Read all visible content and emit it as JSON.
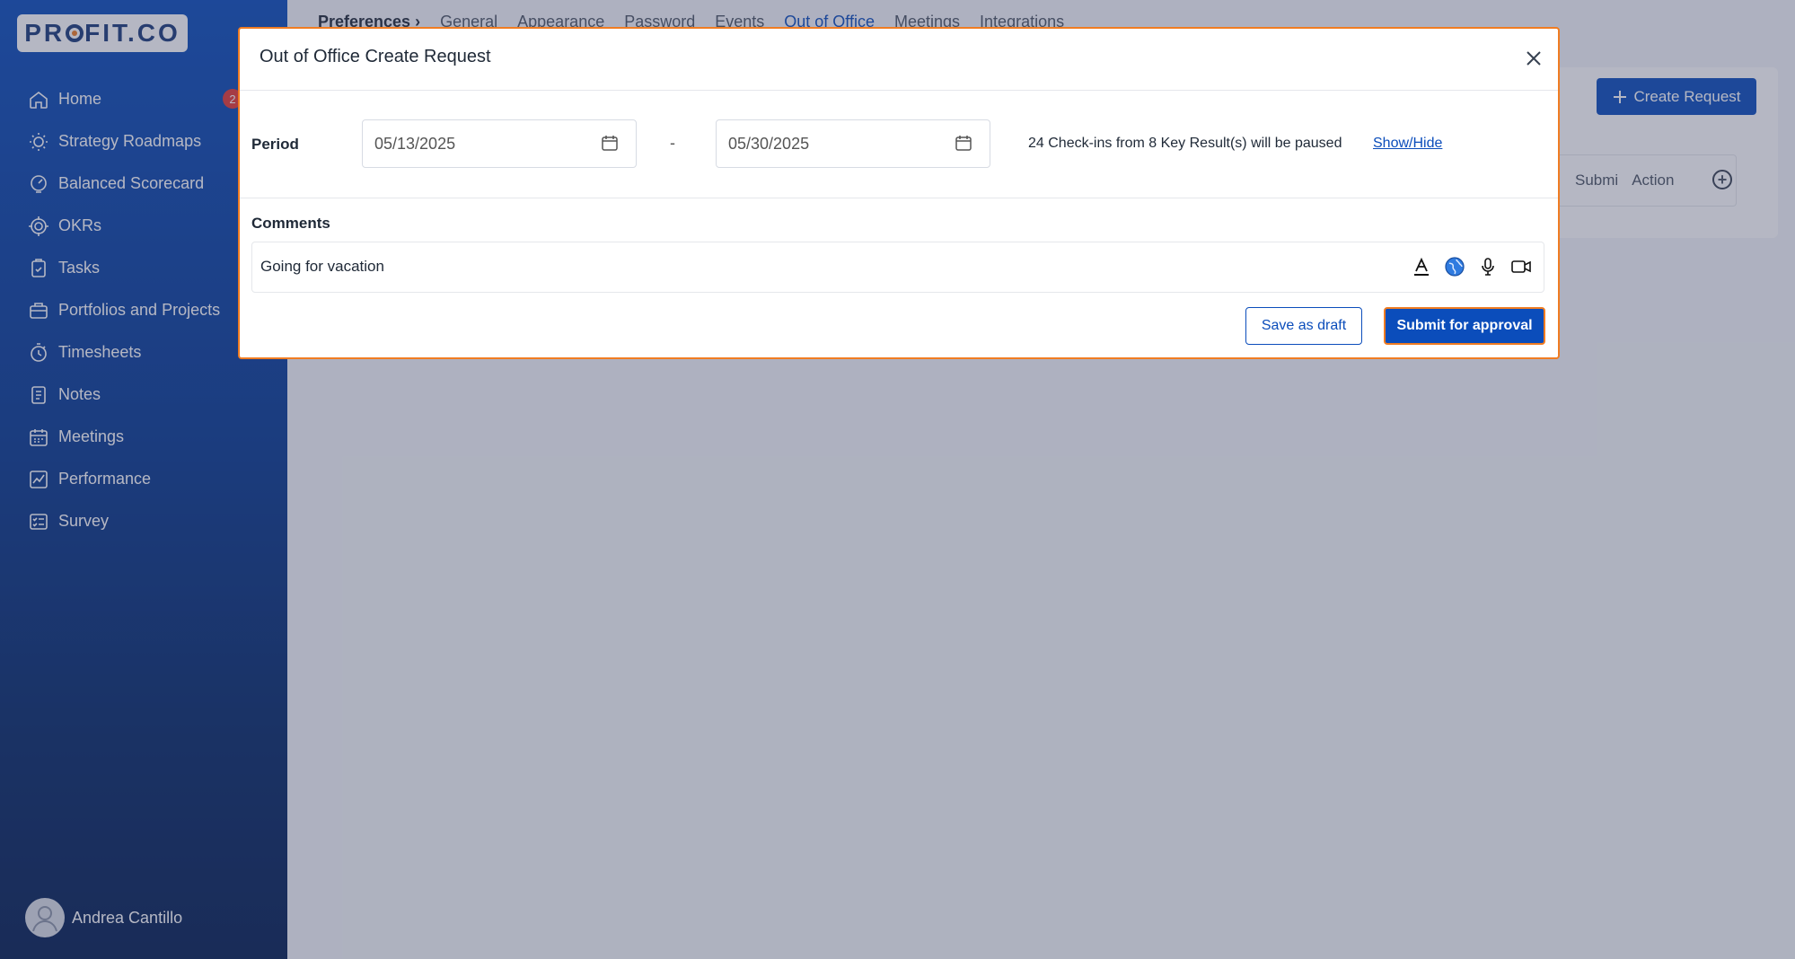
{
  "brand": {
    "logo_pre": "PR",
    "logo_post": "FIT.CO"
  },
  "sidebar": {
    "items": [
      {
        "label": "Home",
        "icon": "home-icon",
        "badge": "2"
      },
      {
        "label": "Strategy Roadmaps",
        "icon": "bulb-icon"
      },
      {
        "label": "Balanced Scorecard",
        "icon": "scorecard-icon"
      },
      {
        "label": "OKRs",
        "icon": "target-icon"
      },
      {
        "label": "Tasks",
        "icon": "clipboard-icon"
      },
      {
        "label": "Portfolios and Projects",
        "icon": "briefcase-icon"
      },
      {
        "label": "Timesheets",
        "icon": "stopwatch-icon"
      },
      {
        "label": "Notes",
        "icon": "notes-icon"
      },
      {
        "label": "Meetings",
        "icon": "calendar-icon"
      },
      {
        "label": "Performance",
        "icon": "chart-icon"
      },
      {
        "label": "Survey",
        "icon": "survey-icon"
      }
    ],
    "user_name": "Andrea Cantillo"
  },
  "topnav": {
    "breadcrumb": "Preferences",
    "breadcrumb_sep": "›",
    "tabs": [
      "General",
      "Appearance",
      "Password",
      "Events",
      "Out of Office",
      "Meetings",
      "Integrations"
    ],
    "active_tab": "Out of Office"
  },
  "background": {
    "create_button": "Create Request",
    "columns": [
      "Submi",
      "Action"
    ]
  },
  "modal": {
    "title": "Out of Office Create Request",
    "period_label": "Period",
    "start_date": "05/13/2025",
    "end_date": "05/30/2025",
    "range_separator": "-",
    "pause_info": "24 Check-ins from 8 Key Result(s) will be paused",
    "show_hide": "Show/Hide",
    "comments_label": "Comments",
    "comment_value": "Going for vacation",
    "draft_button": "Save as draft",
    "submit_button": "Submit for approval"
  },
  "colors": {
    "brand_blue": "#0b4dbb",
    "highlight_orange": "#f07c22",
    "badge_red": "#e53935"
  }
}
